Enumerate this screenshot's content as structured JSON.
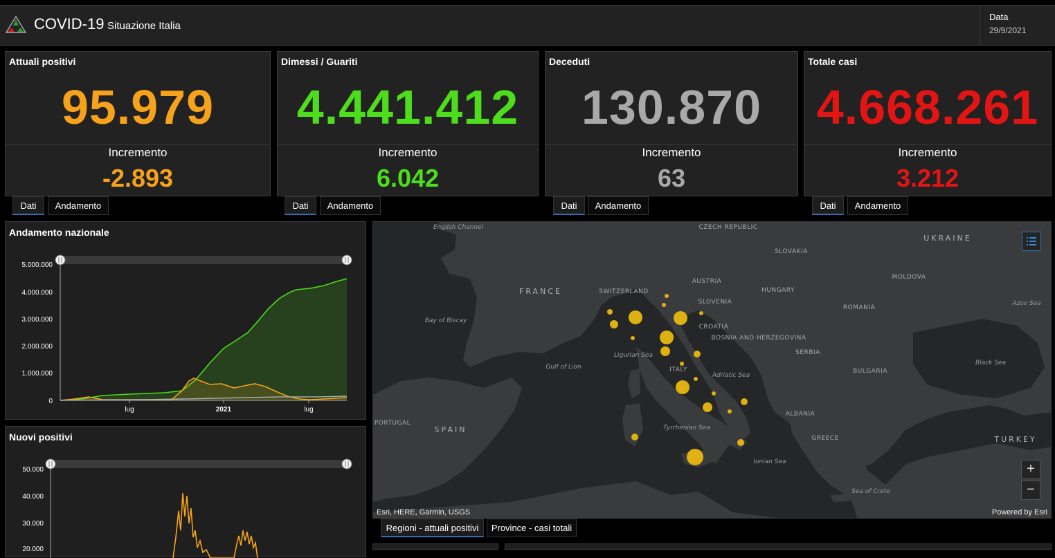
{
  "header": {
    "title": "COVID-19",
    "subtitle": "Situazione Italia",
    "date_label": "Data",
    "date_value": "29/9/2021"
  },
  "cards": [
    {
      "title": "Attuali positivi",
      "value": "95.979",
      "inc_label": "Incremento",
      "inc_value": "-2.893",
      "color": "#f7a21b"
    },
    {
      "title": "Dimessi / Guariti",
      "value": "4.441.412",
      "inc_label": "Incremento",
      "inc_value": "6.042",
      "color": "#4ddd1c"
    },
    {
      "title": "Deceduti",
      "value": "130.870",
      "inc_label": "Incremento",
      "inc_value": "63",
      "color": "#a9a9a9"
    },
    {
      "title": "Totale casi",
      "value": "4.668.261",
      "inc_label": "Incremento",
      "inc_value": "3.212",
      "color": "#e31414"
    }
  ],
  "card_tabs": {
    "dati": "Dati",
    "andamento": "Andamento"
  },
  "andamento": {
    "title": "Andamento nazionale",
    "y_ticks": [
      "5.000.000",
      "4.000.000",
      "3.000.000",
      "2.000.000",
      "1.000.000",
      "0"
    ],
    "x_ticks": [
      "lug",
      "2021",
      "lug"
    ]
  },
  "nuovi": {
    "title": "Nuovi positivi",
    "y_ticks": [
      "50.000",
      "40.000",
      "30.000",
      "20.000"
    ]
  },
  "map": {
    "labels": {
      "english_channel": "English Channel",
      "czech": "CZECH REPUBLIC",
      "ukraine": "UKRAINE",
      "slovakia": "SLOVAKIA",
      "france": "FRANCE",
      "switzerland": "SWITZERLAND",
      "austria": "AUSTRIA",
      "hungary": "HUNGARY",
      "moldova": "MOLDOVA",
      "slovenia": "SLOVENIA",
      "romania": "ROMANIA",
      "azov": "Azov Sea",
      "biscay": "Bay of Biscay",
      "croatia": "CROATIA",
      "bosnia": "BOSNIA AND HERZEGOVINA",
      "ligurian": "Ligurian Sea",
      "serbia": "SERBIA",
      "gulf_lion": "Gulf of Lion",
      "italy": "ITALY",
      "adriatic": "Adriatic Sea",
      "bulgaria": "BULGARIA",
      "black_sea": "Black Sea",
      "portugal": "PORTUGAL",
      "spain": "SPAIN",
      "tyrrhenian": "Tyrrhenian Sea",
      "albania": "ALBANIA",
      "greece": "GREECE",
      "turkey": "TURKEY",
      "ionian": "Ionian Sea",
      "crete": "Sea of Crete"
    },
    "attribution": "Esri, HERE, Garmin, USGS",
    "powered": "Powered by Esri",
    "zoom_in": "+",
    "zoom_out": "−"
  },
  "map_tabs": {
    "regioni": "Regioni - attuali positivi",
    "province": "Province - casi totali"
  },
  "colors": {
    "positivi": "#f7a21b",
    "guariti": "#4ddd1c",
    "deceduti": "#a9a9a9",
    "totale": "#e31414",
    "bubble": "#e8b710",
    "tab_accent": "#2f6fb8"
  }
}
